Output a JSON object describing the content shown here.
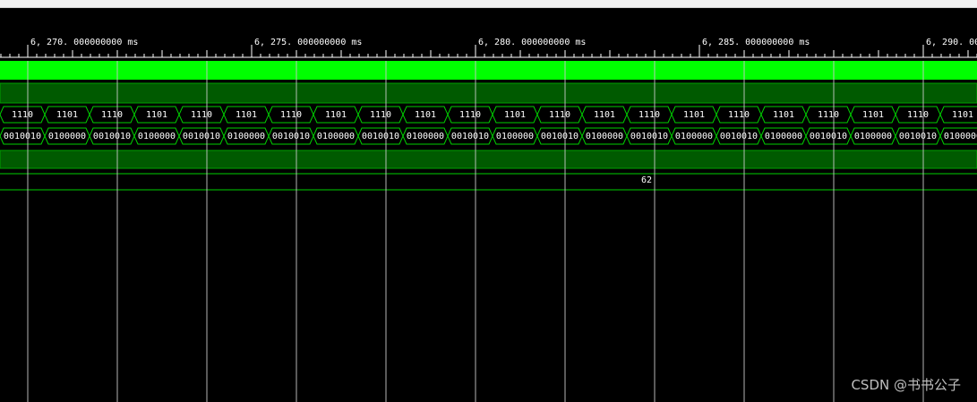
{
  "timeline": {
    "unit": "ms",
    "ticks": [
      "6, 270. 000000000 ms",
      "6, 275. 000000000 ms",
      "6, 280. 000000000 ms",
      "6, 285. 000000000 ms",
      "6, 290. 000000000 ms"
    ]
  },
  "signals": {
    "bus_nibble": {
      "values": [
        "1110",
        "1101",
        "1110",
        "1101",
        "1110",
        "1101",
        "1110",
        "1101",
        "1110",
        "1101",
        "1110",
        "1101",
        "1110",
        "1101",
        "1110",
        "1101",
        "1110",
        "1101",
        "1110",
        "1101",
        "1110",
        "1101"
      ]
    },
    "bus_seg": {
      "values": [
        "0010010",
        "0100000",
        "0010010",
        "0100000",
        "0010010",
        "0100000",
        "0010010",
        "0100000",
        "0010010",
        "0100000",
        "0010010",
        "0100000",
        "0010010",
        "0100000",
        "0010010",
        "0100000",
        "0010010",
        "0100000",
        "0010010",
        "0100000",
        "0010010",
        "0100000"
      ]
    },
    "bus_const": {
      "value": "62"
    }
  },
  "colors": {
    "bright_green": "#00ff00",
    "dark_green": "#005a00",
    "bus_line": "#00d000",
    "grid_line": "#c8c8c8",
    "background": "#000000"
  },
  "watermark": "CSDN @书书公子"
}
